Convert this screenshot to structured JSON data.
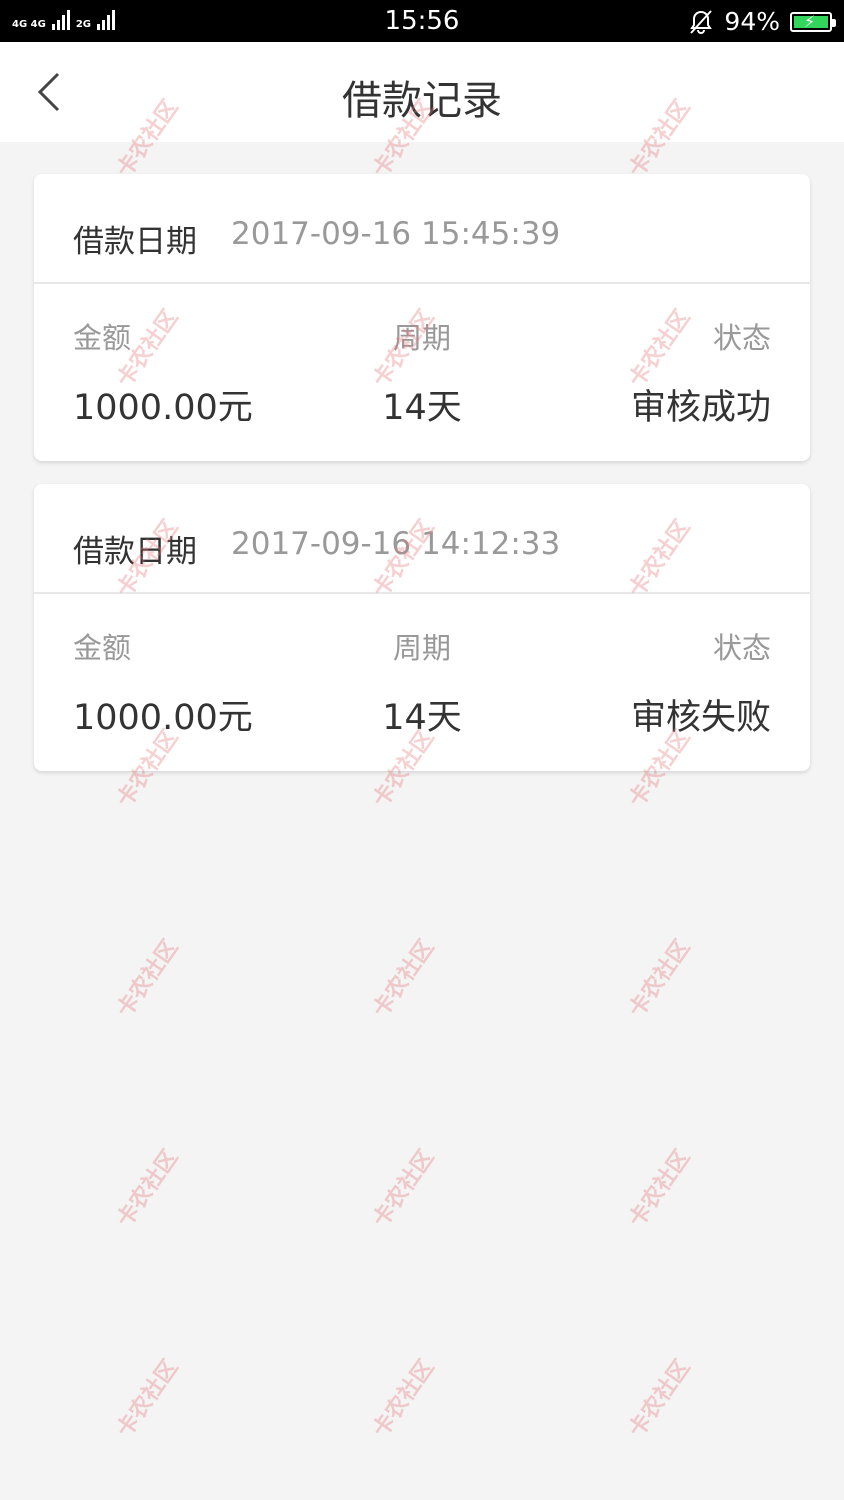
{
  "status_bar": {
    "network_1": "4G 4G",
    "network_2": "2G",
    "time": "15:56",
    "battery_percent": "94%",
    "battery_color": "#31d65a"
  },
  "nav": {
    "title": "借款记录",
    "back_icon": "chevron-left-icon"
  },
  "records": [
    {
      "date_label": "借款日期",
      "date": "2017-09-16 15:45:39",
      "amount_label": "金额",
      "amount": "1000.00元",
      "period_label": "周期",
      "period": "14天",
      "status_label": "状态",
      "status": "审核成功"
    },
    {
      "date_label": "借款日期",
      "date": "2017-09-16 14:12:33",
      "amount_label": "金额",
      "amount": "1000.00元",
      "period_label": "周期",
      "period": "14天",
      "status_label": "状态",
      "status": "审核失败"
    }
  ],
  "watermark_text": "卡农社区"
}
